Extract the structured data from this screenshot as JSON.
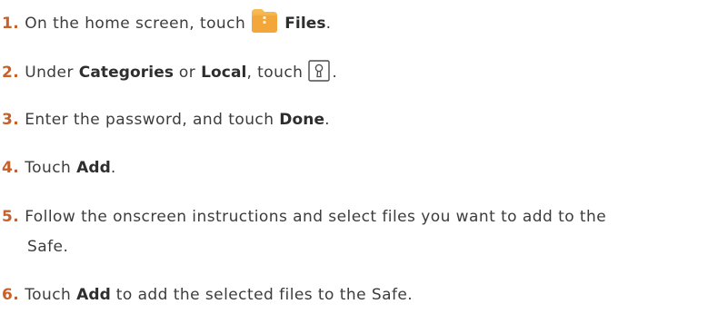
{
  "steps": [
    {
      "number": "1.",
      "text_before": "On the home screen, touch",
      "icon": "files-app-icon",
      "bold": "Files",
      "text_after": "."
    },
    {
      "number": "2.",
      "text_before": "Under ",
      "bold1": "Categories",
      "text_mid": " or ",
      "bold2": "Local",
      "text_after": ", touch",
      "icon": "safe-keyhole-icon",
      "tail": "."
    },
    {
      "number": "3.",
      "text_before": "Enter the password, and touch ",
      "bold": "Done",
      "text_after": "."
    },
    {
      "number": "4.",
      "text_before": "Touch ",
      "bold": "Add",
      "text_after": "."
    },
    {
      "number": "5.",
      "line1": "Follow the onscreen instructions and select files you want to add to the",
      "line2": "Safe."
    },
    {
      "number": "6.",
      "text_before": "Touch ",
      "bold": "Add",
      "text_after": " to add the selected files to the Safe."
    }
  ],
  "colors": {
    "step_number": "#c8602a",
    "body_text": "#3c3c3c",
    "files_icon": "#f0a63c"
  }
}
